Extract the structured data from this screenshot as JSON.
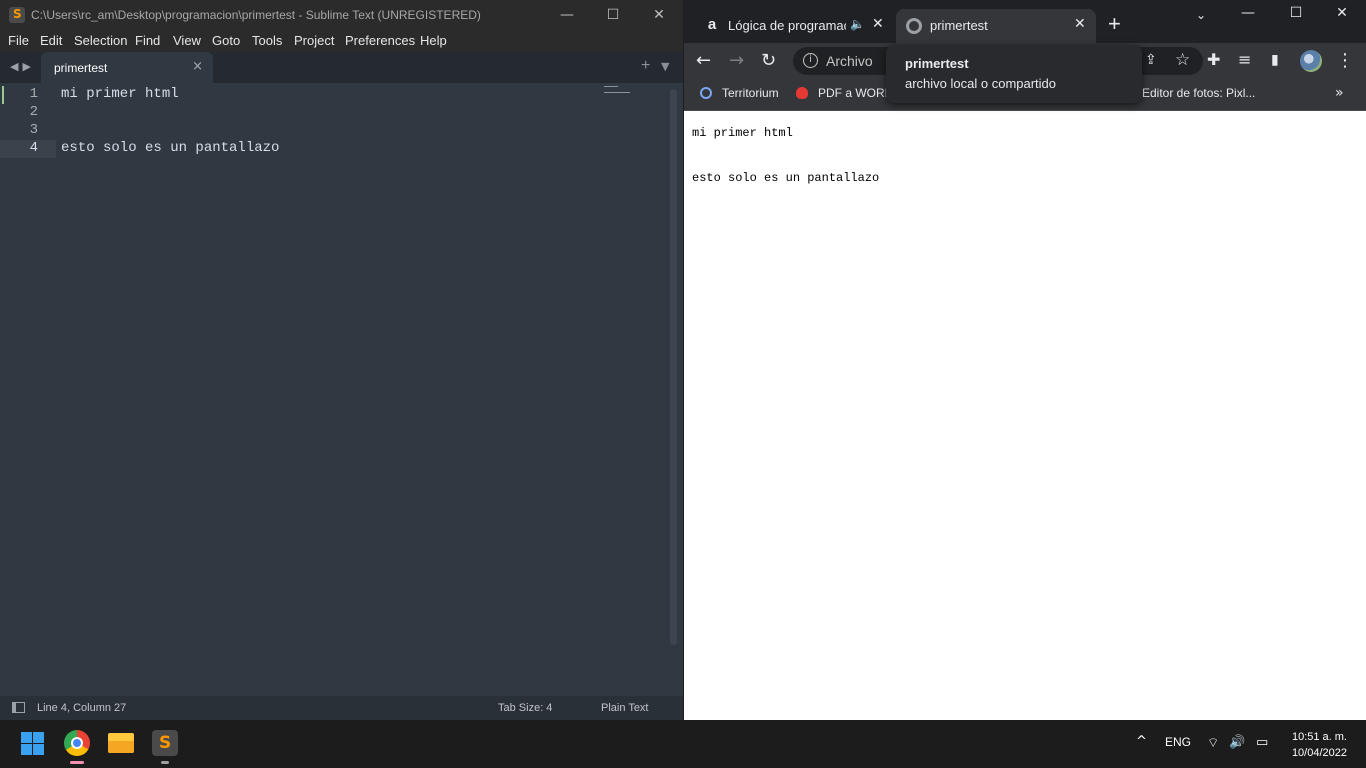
{
  "sublime": {
    "title": "C:\\Users\\rc_am\\Desktop\\programacion\\primertest - Sublime Text (UNREGISTERED)",
    "menu": [
      "File",
      "Edit",
      "Selection",
      "Find",
      "View",
      "Goto",
      "Tools",
      "Project",
      "Preferences",
      "Help"
    ],
    "tab": {
      "label": "primertest",
      "close": "×"
    },
    "nav_arrows": "◀▶",
    "tab_plus": "+",
    "tab_down": "▼",
    "lines": [
      {
        "num": "1",
        "text": "mi primer html"
      },
      {
        "num": "2",
        "text": ""
      },
      {
        "num": "3",
        "text": ""
      },
      {
        "num": "4",
        "text": "esto solo es un pantallazo"
      }
    ],
    "status": {
      "position": "Line 4, Column 27",
      "tab_size": "Tab Size: 4",
      "syntax": "Plain Text"
    },
    "window_buttons": {
      "minimize": "—",
      "maximize": "☐",
      "close": "✕"
    }
  },
  "chrome": {
    "tabs": [
      {
        "title": "Lógica de programaci",
        "audio": "🔈",
        "close": "✕"
      },
      {
        "title": "primertest",
        "close": "✕"
      }
    ],
    "new_tab": "+",
    "tab_search": "⌄",
    "window_buttons": {
      "minimize": "—",
      "maximize": "☐",
      "close": "✕"
    },
    "toolbar": {
      "back": "←",
      "forward": "→",
      "reload": "↻",
      "omnibox_chip": "Archivo",
      "share": "⇪",
      "star": "☆",
      "extensions": "✚",
      "media": "≡",
      "side_panel": "▮",
      "menu": "⋮"
    },
    "bookmarks": [
      {
        "label": "Territorium"
      },
      {
        "label": "PDF a WORD"
      },
      {
        "label": "Editor de fotos: Pixl..."
      }
    ],
    "bookmarks_more": "»",
    "tooltip": {
      "title": "primertest",
      "subtitle": "archivo local o compartido"
    },
    "page_lines": [
      "mi primer html",
      "esto solo es un pantallazo"
    ]
  },
  "taskbar": {
    "apps": [
      "start",
      "chrome",
      "file-explorer",
      "sublime-text"
    ],
    "tray": {
      "chevron": "^",
      "language": "ENG",
      "wifi": "⌔",
      "volume": "🔊",
      "battery": "▭"
    },
    "time": "10:51 a. m.",
    "date": "10/04/2022"
  }
}
